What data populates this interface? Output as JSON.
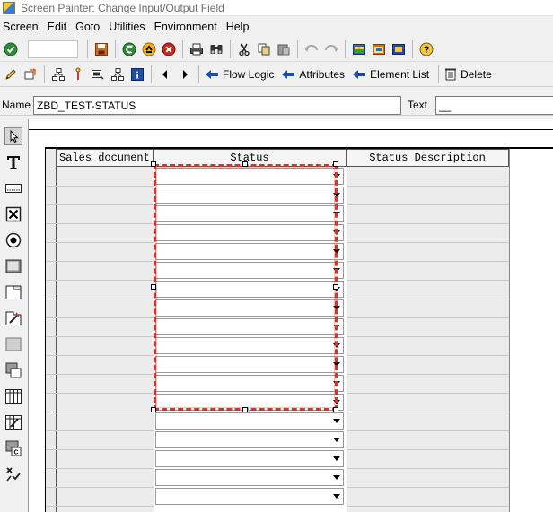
{
  "window": {
    "title": "Screen Painter: Change Input/Output Field"
  },
  "menubar": {
    "items": [
      "Screen",
      "Edit",
      "Goto",
      "Utilities",
      "Environment",
      "Help"
    ]
  },
  "toolbar1": {
    "icons": [
      "check-icon",
      "save-icon",
      "back-icon",
      "exit-icon",
      "cancel-icon",
      "print-icon",
      "find-icon",
      "cut-icon",
      "copy-icon",
      "paste-icon",
      "undo-icon",
      "redo-icon",
      "layout-icon",
      "window-icon",
      "frame-icon",
      "help-icon"
    ]
  },
  "toolbar2": {
    "flow_logic_label": "Flow Logic",
    "attributes_label": "Attributes",
    "element_list_label": "Element List",
    "delete_label": "Delete"
  },
  "element": {
    "name_label": "Name",
    "name_value": "ZBD_TEST-STATUS",
    "text_label": "Text",
    "text_value": "__"
  },
  "palette": {
    "tools": [
      "pointer-icon",
      "text-field-icon",
      "io-field-icon",
      "checkbox-icon",
      "radio-button-icon",
      "pushbutton-icon",
      "tabstrip-icon",
      "tabstrip-wizard-icon",
      "box-icon",
      "subscreen-icon",
      "table-control-icon",
      "table-control-wizard-icon",
      "custom-control-icon",
      "status-icon"
    ]
  },
  "table_control": {
    "columns": [
      {
        "header": "Sales document"
      },
      {
        "header": "Status"
      },
      {
        "header": "Status Description"
      }
    ],
    "visible_rows": 18
  },
  "colors": {
    "selection": "#d6332a",
    "canvas": "#ffffff",
    "column_fill": "#ececec"
  }
}
